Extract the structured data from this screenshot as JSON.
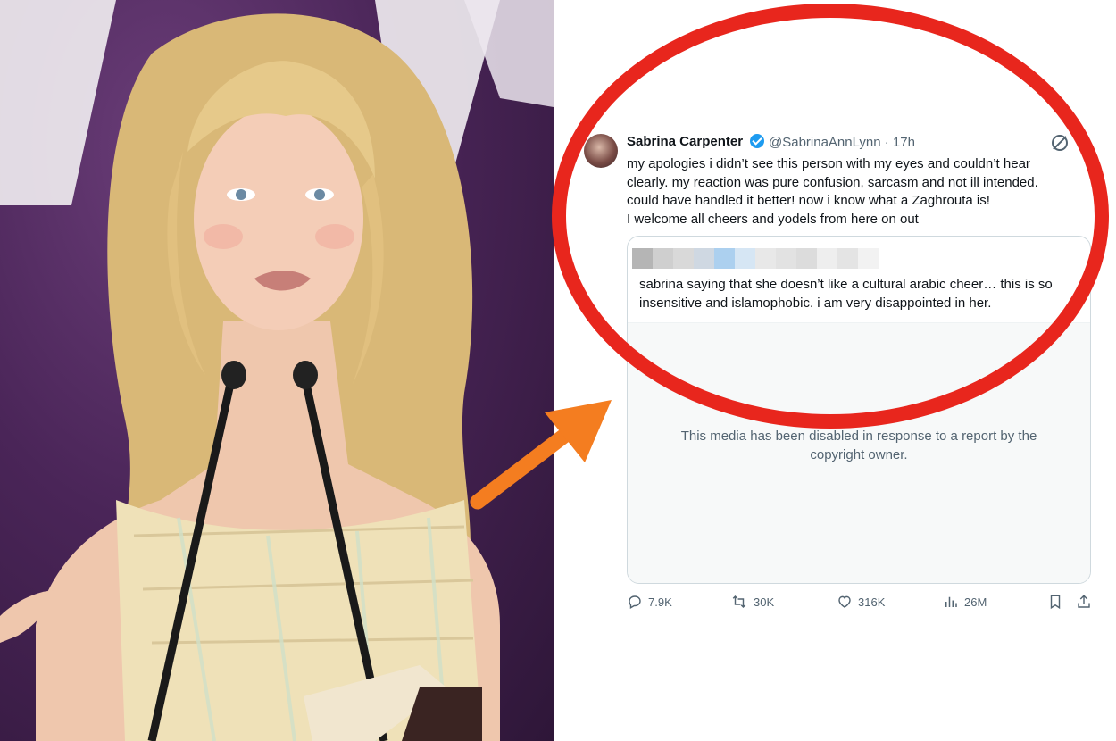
{
  "tweet": {
    "author_name": "Sabrina Carpenter",
    "handle_time": "@SabrinaAnnLynn · 17h",
    "body_lines": [
      "my apologies i didn’t see this person with my eyes and couldn’t hear",
      "clearly. my reaction was pure confusion, sarcasm and not ill intended.",
      "could have handled it better! now i know what a Zaghrouta is!",
      "I welcome all cheers and yodels from here on out"
    ],
    "quoted": {
      "text_lines": [
        "sabrina saying that she doesn’t like a cultural arabic cheer… this is so",
        "insensitive and islamophobic. i am very disappointed in her."
      ],
      "media_notice_lines": [
        "This media has been disabled in response to a report by the",
        "copyright owner."
      ]
    },
    "actions": {
      "replies": "7.9K",
      "reposts": "30K",
      "likes": "316K",
      "views": "26M"
    }
  },
  "colors": {
    "annotation_ring": "#e8261d",
    "arrow": "#f47d20",
    "verified": "#1d9bf0",
    "text_primary": "#0f1419",
    "text_secondary": "#536471"
  },
  "icons": [
    "verified-badge-icon",
    "grok-icon",
    "reply-icon",
    "repost-icon",
    "like-icon",
    "views-icon",
    "bookmark-icon",
    "share-icon"
  ]
}
